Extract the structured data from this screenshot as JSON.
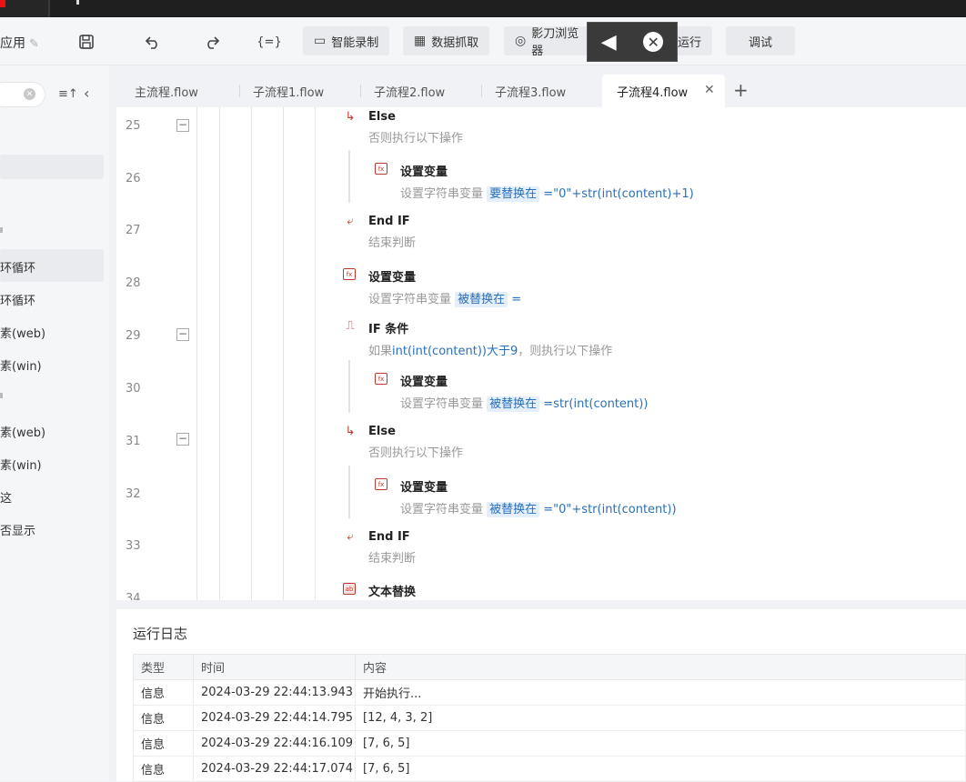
{
  "toolbar": {
    "app_label": "应用",
    "undo_icon": "undo-icon",
    "redo_icon": "redo-icon",
    "code_icon": "{=}",
    "smart_record": "智能录制",
    "data_grab": "数据抓取",
    "browser": "影刀浏览器",
    "run": "运行",
    "debug": "调试"
  },
  "sidebar": {
    "items": [
      "环循环",
      "环循环",
      "素(web)",
      "素(win)",
      "素(web)",
      "素(win)",
      "这",
      "否显示"
    ]
  },
  "tabs": [
    {
      "label": "主流程.flow"
    },
    {
      "label": "子流程1.flow"
    },
    {
      "label": "子流程2.flow"
    },
    {
      "label": "子流程3.flow"
    },
    {
      "label": "子流程4.flow"
    }
  ],
  "editor": {
    "line_numbers": [
      "25",
      "26",
      "27",
      "28",
      "29",
      "30",
      "31",
      "32",
      "33",
      "34"
    ],
    "b25_title": "Else",
    "b25_desc": "否则执行以下操作",
    "b26_title": "设置变量",
    "b26_desc_pre": "设置字符串变量 ",
    "b26_var": "要替换在",
    "b26_expr": " =\"0\"+str(int(content)+1)",
    "b27_title": "End IF",
    "b27_desc": "结束判断",
    "b28_title": "设置变量",
    "b28_desc_pre": "设置字符串变量 ",
    "b28_var": "被替换在",
    "b28_expr": " =",
    "b29_title": "IF 条件",
    "b29_desc_pre": "如果",
    "b29_cond": "int(int(content))大于9",
    "b29_desc_post": "，则执行以下操作",
    "b30_title": "设置变量",
    "b30_desc_pre": "设置字符串变量 ",
    "b30_var": "被替换在",
    "b30_expr": " =str(int(content))",
    "b31_title": "Else",
    "b31_desc": "否则执行以下操作",
    "b32_title": "设置变量",
    "b32_desc_pre": "设置字符串变量 ",
    "b32_var": "被替换在",
    "b32_expr": " =\"0\"+str(int(content))",
    "b33_title": "End IF",
    "b33_desc": "结束判断",
    "b34_title": "文本替换"
  },
  "log": {
    "title": "运行日志",
    "headers": [
      "类型",
      "时间",
      "内容"
    ],
    "rows": [
      [
        "信息",
        "2024-03-29 22:44:13.943",
        "开始执行..."
      ],
      [
        "信息",
        "2024-03-29 22:44:14.795",
        "[12, 4, 3, 2]"
      ],
      [
        "信息",
        "2024-03-29 22:44:16.109",
        "[7, 6, 5]"
      ],
      [
        "信息",
        "2024-03-29 22:44:17.074",
        "[7, 6, 5]"
      ]
    ]
  }
}
